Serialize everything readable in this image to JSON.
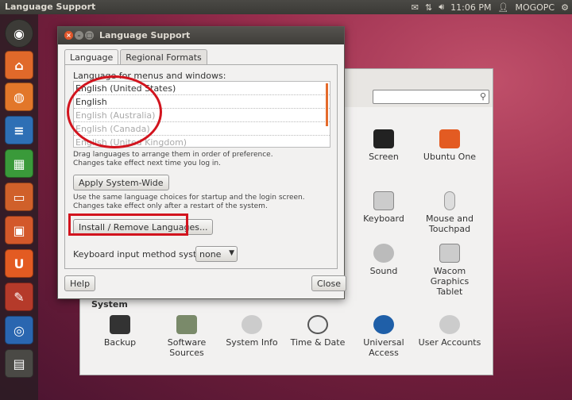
{
  "topbar": {
    "title": "Language Support",
    "time": "11:06 PM",
    "user": "MOGOPC"
  },
  "launcher": {
    "items": [
      "dash-icon",
      "home-folder-icon",
      "firefox-icon",
      "writer-icon",
      "calc-icon",
      "impress-icon",
      "software-center-icon",
      "ubuntu-one-icon",
      "system-settings-icon",
      "workspace-switcher-icon",
      "workspace-icon"
    ]
  },
  "settings": {
    "items": [
      {
        "label": "Screen"
      },
      {
        "label": "Ubuntu One"
      },
      {
        "label": "Keyboard"
      },
      {
        "label": "Mouse and Touchpad"
      },
      {
        "label": "Sound"
      },
      {
        "label": "Wacom Graphics Tablet"
      },
      {
        "label": "Backup"
      },
      {
        "label": "Software Sources"
      },
      {
        "label": "System Info"
      },
      {
        "label": "Time & Date"
      },
      {
        "label": "Universal Access"
      },
      {
        "label": "User Accounts"
      }
    ],
    "section_system": "System"
  },
  "dialog": {
    "title": "Language Support",
    "tabs": [
      "Language",
      "Regional Formats"
    ],
    "lang_label": "Language for menus and windows:",
    "languages": [
      {
        "name": "English (United States)",
        "dim": false
      },
      {
        "name": "English",
        "dim": false
      },
      {
        "name": "English (Australia)",
        "dim": true
      },
      {
        "name": "English (Canada)",
        "dim": true
      },
      {
        "name": "English (United Kingdom)",
        "dim": true
      }
    ],
    "drag_note_1": "Drag languages to arrange them in order of preference.",
    "drag_note_2": "Changes take effect next time you log in.",
    "apply_button": "Apply System-Wide",
    "apply_note_1": "Use the same language choices for startup and the login screen.",
    "apply_note_2": "Changes take effect only after a restart of the system.",
    "install_button": "Install / Remove Languages...",
    "keyboard_label": "Keyboard input method system:",
    "keyboard_value": "none",
    "help_button": "Help",
    "close_button": "Close"
  },
  "colors": {
    "accent": "#e46b2c",
    "highlight": "#d2141e"
  }
}
